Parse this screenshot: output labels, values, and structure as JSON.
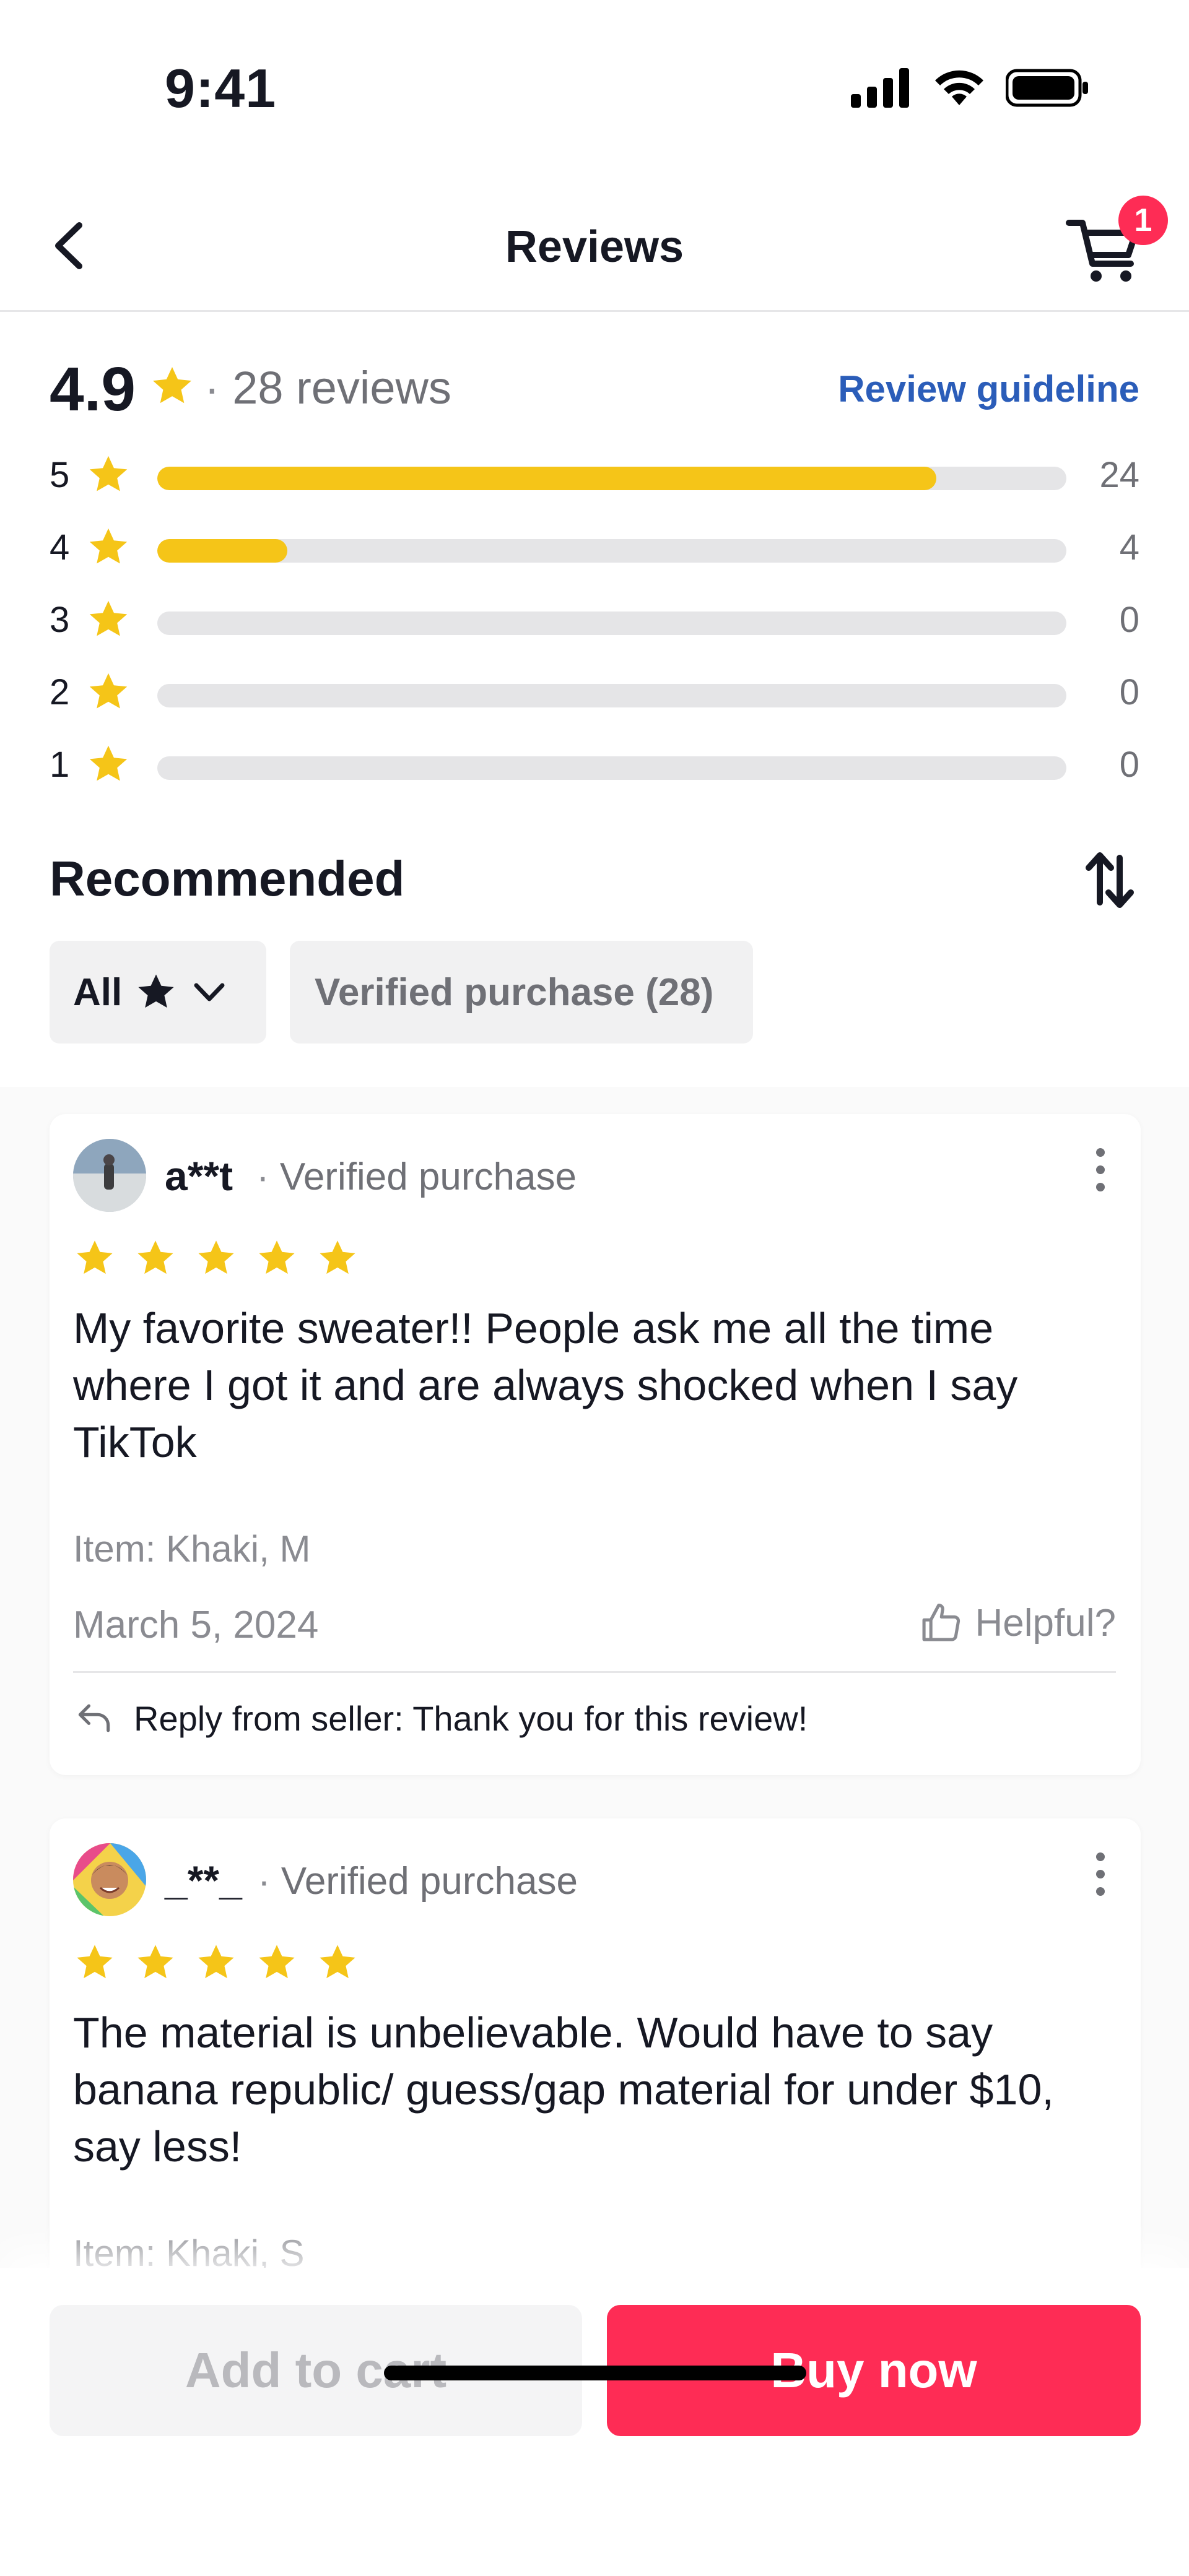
{
  "status_bar": {
    "time": "9:41",
    "icons": [
      "signal-icon",
      "wifi-icon",
      "battery-icon"
    ]
  },
  "nav": {
    "title": "Reviews",
    "back_icon": "chevron-left-icon",
    "cart_icon": "cart-icon",
    "cart_badge": "1"
  },
  "summary": {
    "rating": "4.9",
    "separator": "·",
    "review_count": "28 reviews",
    "guideline_link": "Review guideline"
  },
  "distribution": [
    {
      "stars": "5",
      "count": "24",
      "fraction": 0.8571
    },
    {
      "stars": "4",
      "count": "4",
      "fraction": 0.1429
    },
    {
      "stars": "3",
      "count": "0",
      "fraction": 0
    },
    {
      "stars": "2",
      "count": "0",
      "fraction": 0
    },
    {
      "stars": "1",
      "count": "0",
      "fraction": 0
    }
  ],
  "filters": {
    "section_title": "Recommended",
    "sort_icon": "sort-icon",
    "all_label": "All",
    "verified_label": "Verified purchase (28)"
  },
  "reviews": [
    {
      "username": "a**t",
      "separator": "·",
      "tag": "Verified purchase",
      "rating": 5,
      "text": "My favorite sweater!! People ask me all the time where I got it and are always shocked when I say TikTok",
      "item": "Item: Khaki, M",
      "date": "March 5, 2024",
      "helpful": "Helpful?",
      "seller_reply": "Reply from seller: Thank you for this review!"
    },
    {
      "username": "_**_",
      "separator": "·",
      "tag": "Verified purchase",
      "rating": 5,
      "text": "The material is unbelievable. Would have to say banana republic/ guess/gap material for under $10, say less!",
      "item": "Item: Khaki, S"
    }
  ],
  "actions": {
    "add_to_cart": "Add to cart",
    "buy_now": "Buy now"
  },
  "colors": {
    "accent": "#fe2c55",
    "star": "#f5c518",
    "link": "#2b5db9",
    "muted_text": "#6f7076"
  }
}
